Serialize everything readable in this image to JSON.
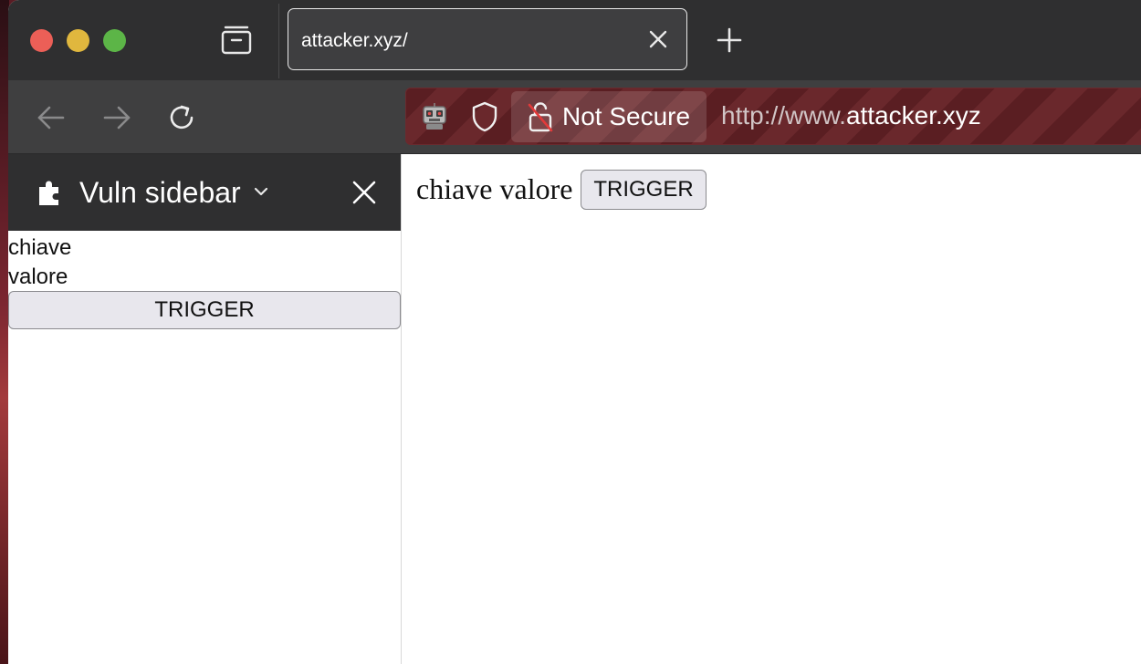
{
  "tab": {
    "title": "attacker.xyz/"
  },
  "urlbar": {
    "security_label": "Not Secure",
    "url_prefix": "http://www.",
    "url_domain": "attacker.xyz"
  },
  "sidebar": {
    "title": "Vuln sidebar",
    "key_text": "chiave",
    "value_text": "valore",
    "trigger_label": "TRIGGER"
  },
  "page": {
    "text": "chiave valore",
    "trigger_label": "TRIGGER"
  },
  "colors": {
    "traffic_red": "#ec5f57",
    "traffic_yellow": "#e0b73e",
    "traffic_green": "#5cb547",
    "chrome_dark": "#2f2f30",
    "insecure_urlbar": "#5a1e22"
  },
  "icons": [
    "close-window",
    "minimize-window",
    "zoom-window",
    "tab-overview-icon",
    "close-icon",
    "plus-icon",
    "back-arrow-icon",
    "forward-arrow-icon",
    "reload-icon",
    "robot-icon",
    "shield-icon",
    "lock-slash-icon",
    "puzzle-icon",
    "chevron-down-icon"
  ]
}
